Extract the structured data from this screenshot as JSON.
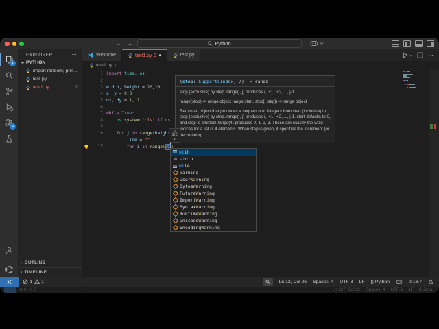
{
  "theme": {
    "kw": "#c586c0",
    "type": "#4ec9b0",
    "vr": "#9cdcfe",
    "num": "#b5cea8",
    "str": "#ce9178",
    "fn": "#dcdcaa",
    "cst": "#569cd6",
    "fg": "#d4d4d4",
    "br": "#e2b86b",
    "match1": "#45a8ff",
    "match2": "#d7ba7d",
    "accent": "#327ac9",
    "error": "#e0756b",
    "badge": "#2584d6",
    "selrow": "#04395e",
    "traffic_red": "#ff5f57",
    "traffic_yellow": "#febc2e",
    "traffic_green": "#28c840"
  },
  "title_bar": {
    "search_text": "Python",
    "back": "←",
    "forward": "→"
  },
  "activity_bar": {
    "explorer_badge": "1",
    "extensions_badge": "6"
  },
  "explorer": {
    "header": "EXPLORER",
    "menu": "⋯",
    "section": "PYTHON",
    "files": [
      {
        "label": "import random; prin...",
        "error": false,
        "count": ""
      },
      {
        "label": "test.py",
        "error": false,
        "count": ""
      },
      {
        "label": "test1.py",
        "error": true,
        "count": "2"
      }
    ],
    "outline": "OUTLINE",
    "timeline": "TIMELINE",
    "chevron": "›"
  },
  "tabs": [
    {
      "label": "Welcome"
    },
    {
      "label": "test1.py",
      "problems": "2",
      "dot": "●"
    },
    {
      "label": "test.py"
    }
  ],
  "breadcrumb": {
    "file": "test1.py",
    "sep": "›",
    "more": "…"
  },
  "editor": {
    "lines": [
      {
        "n": "1",
        "segs": [
          [
            "k",
            "import"
          ],
          [
            "p",
            " "
          ],
          [
            "t",
            "time"
          ],
          [
            "p",
            ", "
          ],
          [
            "t",
            "os"
          ]
        ]
      },
      {
        "n": "2",
        "segs": []
      },
      {
        "n": "3",
        "segs": [
          [
            "v",
            "width"
          ],
          [
            "p",
            ", "
          ],
          [
            "v",
            "height"
          ],
          [
            "p",
            " = "
          ],
          [
            "n",
            "20"
          ],
          [
            "p",
            ","
          ],
          [
            "n",
            "10"
          ]
        ]
      },
      {
        "n": "4",
        "segs": [
          [
            "v",
            "x"
          ],
          [
            "p",
            ", "
          ],
          [
            "v",
            "y"
          ],
          [
            "p",
            " = "
          ],
          [
            "n",
            "0"
          ],
          [
            "p",
            ","
          ],
          [
            "n",
            "0"
          ]
        ]
      },
      {
        "n": "5",
        "segs": [
          [
            "v",
            "dx"
          ],
          [
            "p",
            ", "
          ],
          [
            "v",
            "dy"
          ],
          [
            "p",
            " = "
          ],
          [
            "n",
            "1"
          ],
          [
            "p",
            ", "
          ],
          [
            "n",
            "1"
          ]
        ]
      },
      {
        "n": "6",
        "segs": []
      },
      {
        "n": "7",
        "segs": [
          [
            "k",
            "while"
          ],
          [
            "p",
            " "
          ],
          [
            "c",
            "True"
          ],
          [
            "p",
            ":"
          ]
        ]
      },
      {
        "n": "8",
        "segs": [
          [
            "p",
            "    "
          ],
          [
            "t",
            "os"
          ],
          [
            "p",
            "."
          ],
          [
            "f",
            "system"
          ],
          [
            "b",
            "("
          ],
          [
            "s",
            "\"cls\""
          ],
          [
            "p",
            " "
          ],
          [
            "k",
            "if"
          ],
          [
            "p",
            " "
          ],
          [
            "t",
            "os"
          ]
        ]
      },
      {
        "n": "9",
        "segs": []
      },
      {
        "n": "10",
        "segs": [
          [
            "p",
            "    "
          ],
          [
            "k",
            "for"
          ],
          [
            "p",
            " "
          ],
          [
            "v",
            "j"
          ],
          [
            "p",
            " "
          ],
          [
            "k",
            "in"
          ],
          [
            "p",
            " "
          ],
          [
            "f",
            "range"
          ],
          [
            "b",
            "("
          ],
          [
            "v",
            "height"
          ]
        ]
      },
      {
        "n": "11",
        "segs": [
          [
            "p",
            "        "
          ],
          [
            "v",
            "line"
          ],
          [
            "p",
            " = "
          ],
          [
            "s",
            "\"\""
          ]
        ]
      },
      {
        "n": "12",
        "active": true,
        "segs": [
          [
            "p",
            "        "
          ],
          [
            "k",
            "for"
          ],
          [
            "p",
            " "
          ],
          [
            "v",
            "i"
          ],
          [
            "p",
            " "
          ],
          [
            "k",
            "in"
          ],
          [
            "p",
            " "
          ],
          [
            "f",
            "range"
          ],
          [
            "b",
            "("
          ],
          [
            "w",
            "wi"
          ],
          [
            "cur",
            ""
          ],
          [
            "b",
            ")"
          ]
        ]
      }
    ]
  },
  "signature_help": {
    "sig_open": "(",
    "sig_param": "stop",
    "sig_sep": ": ",
    "sig_type": "SupportsIndex",
    "sig_rest": ", /) -> range",
    "pager": "1/2",
    "pager_up": "∧",
    "pager_down": "∨",
    "p1": "stop (exclusive) by step. range(i, j) produces i, i+1, i+2, ..., j-1.",
    "p2": "range(stop) -> range object range(start, stop[, step]) -> range object",
    "p3": "Return an object that produces a sequence of integers from start (inclusive) to stop (exclusive) by step. range(i, j) produces i, i+1, i+2, ..., j-1. start defaults to 0, and stop is omitted! range(4) produces 0, 1, 2, 3. These are exactly the valid indices for a list of 4 elements. When step is given, it specifies the increment (or decrement)."
  },
  "suggest": {
    "items": [
      {
        "icon": "kw",
        "sel": true,
        "segs": [
          [
            "wi",
            "b"
          ],
          [
            "th"
          ]
        ]
      },
      {
        "icon": "abc",
        "segs": [
          [
            "wi",
            "b"
          ],
          [
            "dth"
          ]
        ]
      },
      {
        "icon": "kw",
        "segs": [
          [
            "wi",
            "b"
          ],
          [
            "le"
          ]
        ]
      },
      {
        "icon": "cls",
        "segs": [
          [
            "W",
            "g"
          ],
          [
            "arn"
          ],
          [
            "i",
            "g"
          ],
          [
            "ng"
          ]
        ]
      },
      {
        "icon": "cls",
        "segs": [
          [
            "User"
          ],
          [
            "W",
            "g"
          ],
          [
            "arn"
          ],
          [
            "i",
            "g"
          ],
          [
            "ng"
          ]
        ]
      },
      {
        "icon": "cls",
        "segs": [
          [
            "Bytes"
          ],
          [
            "W",
            "g"
          ],
          [
            "arn"
          ],
          [
            "i",
            "g"
          ],
          [
            "ng"
          ]
        ]
      },
      {
        "icon": "cls",
        "segs": [
          [
            "Future"
          ],
          [
            "W",
            "g"
          ],
          [
            "arn"
          ],
          [
            "i",
            "g"
          ],
          [
            "ng"
          ]
        ]
      },
      {
        "icon": "cls",
        "segs": [
          [
            "Import"
          ],
          [
            "W",
            "g"
          ],
          [
            "arn"
          ],
          [
            "i",
            "g"
          ],
          [
            "ng"
          ]
        ]
      },
      {
        "icon": "cls",
        "segs": [
          [
            "Syntax"
          ],
          [
            "W",
            "g"
          ],
          [
            "arn"
          ],
          [
            "i",
            "g"
          ],
          [
            "ng"
          ]
        ]
      },
      {
        "icon": "cls",
        "segs": [
          [
            "Runtime"
          ],
          [
            "W",
            "g"
          ],
          [
            "arn"
          ],
          [
            "i",
            "g"
          ],
          [
            "ng"
          ]
        ]
      },
      {
        "icon": "cls",
        "segs": [
          [
            "Unicode"
          ],
          [
            "W",
            "g"
          ],
          [
            "arn"
          ],
          [
            "i",
            "g"
          ],
          [
            "ng"
          ]
        ]
      },
      {
        "icon": "cls",
        "segs": [
          [
            "Encoding"
          ],
          [
            "W",
            "g"
          ],
          [
            "arn"
          ],
          [
            "i",
            "g"
          ],
          [
            "ng"
          ]
        ]
      }
    ]
  },
  "status_bar": {
    "errors": "1",
    "warnings": "1",
    "line_col": "Ln 12, Col 26",
    "spaces": "Spaces: 4",
    "encoding": "UTF-8",
    "eol": "LF",
    "language": "{} Python",
    "interpreter": "3.13.7"
  },
  "ghost_bar": {
    "errors": "0",
    "warnings": "0",
    "line_col": "Ln 327, Col 22",
    "spaces": "Spaces: 4",
    "encoding": "UTF-8",
    "eol": "LF",
    "language": "{} Java"
  }
}
